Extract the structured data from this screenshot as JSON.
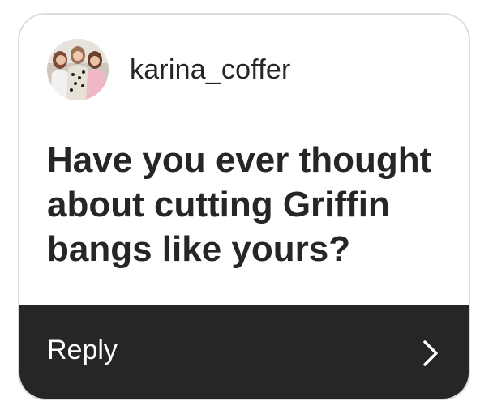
{
  "story_reply": {
    "avatar_icon": "profile-photo-icon",
    "username": "karina_coffer",
    "question": "Have you ever thought about cutting Griffin bangs like yours?",
    "reply_label": "Reply",
    "reply_icon": "chevron-right-icon"
  },
  "colors": {
    "text": "#262626",
    "card_border": "#dcdcdc",
    "reply_bar": "#262626",
    "reply_text": "#ffffff"
  }
}
